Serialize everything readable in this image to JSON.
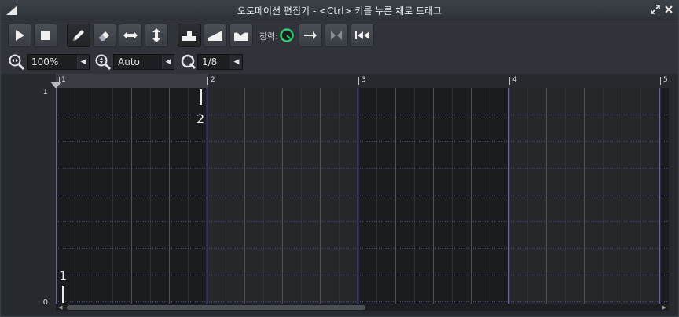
{
  "window": {
    "title": "오토메이션 편집기 - <Ctrl> 키를 누른 채로 드래그"
  },
  "toolbar": {
    "tension_label": "장력:"
  },
  "zoom": {
    "horizontal_value": "100%",
    "vertical_value": "Auto",
    "quantize_value": "1/8"
  },
  "ruler": {
    "bars": [
      "1",
      "2",
      "3",
      "4",
      "5"
    ]
  },
  "yaxis": {
    "max_label": "1",
    "min_label": "0"
  },
  "points": [
    {
      "label": "1"
    },
    {
      "label": "2"
    }
  ],
  "colors": {
    "accent": "#2ecc71",
    "bar_line": "#6a5acd",
    "beat_line": "#4b4a9a",
    "grid_bg_dark": "#1b1c1e",
    "grid_bg_light": "#25272a"
  }
}
